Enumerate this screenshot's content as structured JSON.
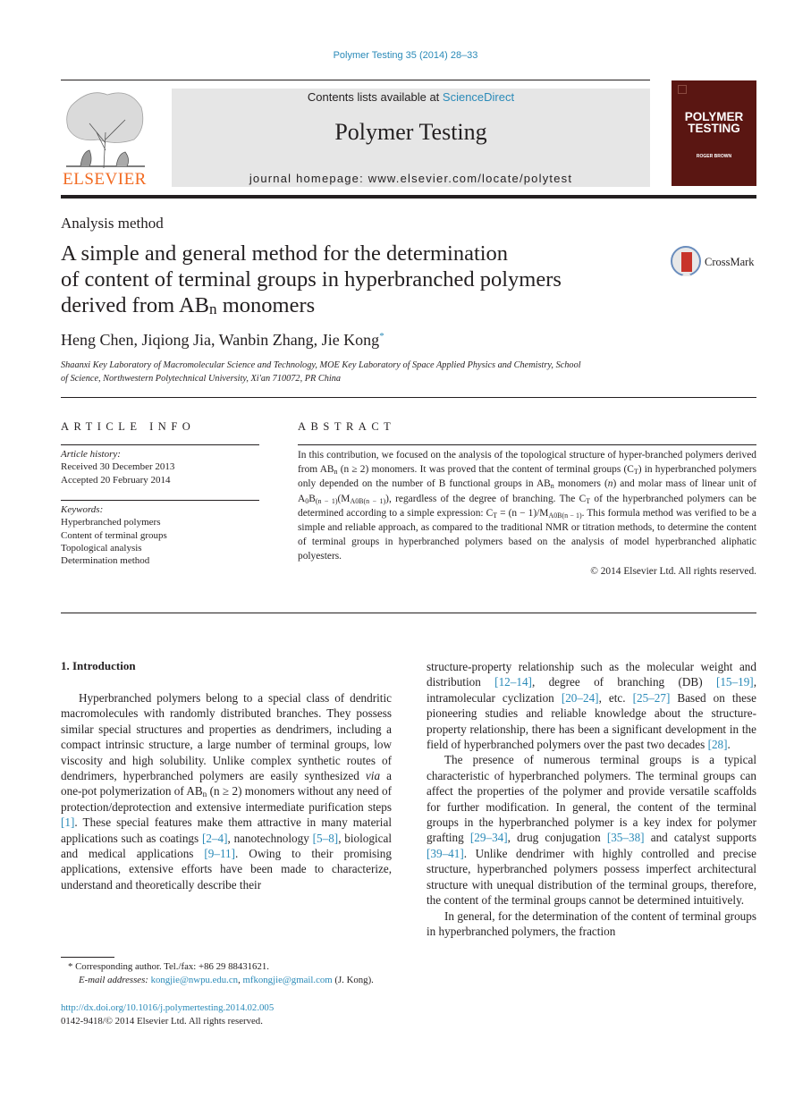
{
  "header": {
    "citation": "Polymer Testing 35 (2014) 28–33",
    "contents_prefix": "Contents lists available at ",
    "contents_link": "ScienceDirect",
    "journal_name": "Polymer Testing",
    "homepage": "journal homepage: www.elsevier.com/locate/polytest",
    "publisher_logo": "ELSEVIER",
    "cover": {
      "title_line1": "POLYMER",
      "title_line2": "TESTING",
      "editor": "ROGER BROWN",
      "bg_color": "#5a1612"
    }
  },
  "article": {
    "section_label": "Analysis method",
    "title_line1": "A simple and general method for the determination",
    "title_line2": "of content of terminal groups in hyperbranched polymers",
    "title_line3_pre": "derived from AB",
    "title_line3_sub": "n",
    "title_line3_post": " monomers",
    "crossmark_label": "CrossMark",
    "authors": "Heng Chen, Jiqiong Jia, Wanbin Zhang, Jie Kong",
    "corresponding_mark": "*",
    "affiliation_line1": "Shaanxi Key Laboratory of Macromolecular Science and Technology, MOE Key Laboratory of Space Applied Physics and Chemistry, School",
    "affiliation_line2": "of Science, Northwestern Polytechnical University, Xi'an 710072, PR China"
  },
  "article_info": {
    "heading": "ARTICLE INFO",
    "history_label": "Article history:",
    "received": "Received 30 December 2013",
    "accepted": "Accepted 20 February 2014",
    "keywords_label": "Keywords:",
    "keywords": [
      "Hyperbranched polymers",
      "Content of terminal groups",
      "Topological analysis",
      "Determination method"
    ]
  },
  "abstract": {
    "heading": "ABSTRACT",
    "s1": "In this contribution, we focused on the analysis of the topological structure of hyper-branched polymers derived from AB",
    "s2": " (n ≥ 2) monomers. It was proved that the content of terminal groups (C",
    "s3": ") in hyperbranched polymers only depended on the number of B functional groups in AB",
    "s4": " monomers (",
    "s4_italic": "n",
    "s5": ") and molar mass of linear unit of A",
    "s5_sub0": "0",
    "s5_b": "B",
    "s5_sub1": "(n − 1)",
    "s6": "(M",
    "s6_sub": "A0B(n − 1)",
    "s7": "), regardless of the degree of branching. The C",
    "s8": " of the hyperbranched polymers can be determined according to a simple expression: C",
    "s9": " = (n − 1)/M",
    "s9_sub": "A0B(n − 1)",
    "s10": ". This formula method was verified to be a simple and reliable approach, as compared to the traditional NMR or titration methods, to determine the content of terminal groups in hyperbranched polymers based on the analysis of model hyperbranched aliphatic polyesters.",
    "sub_n": "n",
    "sub_T": "T",
    "copyright": "© 2014 Elsevier Ltd. All rights reserved."
  },
  "body": {
    "intro_heading": "1.  Introduction",
    "left_p1_a": "Hyperbranched polymers belong to a special class of dendritic macromolecules with randomly distributed branches. They possess similar special structures and properties as dendrimers, including a compact intrinsic structure, a large number of terminal groups, low viscosity and high solubility. Unlike complex synthetic routes of dendrimers, hyperbranched polymers are easily synthesized ",
    "left_p1_via": "via",
    "left_p1_b": " a one-pot polymerization of AB",
    "left_p1_c": " (n ≥ 2) monomers without any need of protection/deprotection and extensive intermediate purification steps ",
    "ref1": "[1]",
    "left_p1_d": ". These special features make them attractive in many material applications such as coatings ",
    "ref2": "[2–4]",
    "left_p1_e": ", nanotechnology ",
    "ref3": "[5–8]",
    "left_p1_f": ", biological and medical applications ",
    "ref4": "[9–11]",
    "left_p1_g": ". Owing to their promising applications, extensive efforts have been made to characterize, understand and theoretically describe their",
    "right_p1_a": "structure-property relationship such as the molecular weight and distribution ",
    "ref5": "[12–14]",
    "right_p1_b": ", degree of branching (DB) ",
    "ref6": "[15–19]",
    "right_p1_c": ", intramolecular cyclization ",
    "ref7": "[20–24]",
    "right_p1_d": ", etc. ",
    "ref8": "[25–27]",
    "right_p1_e": " Based on these pioneering studies and reliable knowledge about the structure-property relationship, there has been a significant development in the field of hyperbranched polymers over the past two decades ",
    "ref9": "[28]",
    "right_p1_f": ".",
    "right_p2_a": "The presence of numerous terminal groups is a typical characteristic of hyperbranched polymers. The terminal groups can affect the properties of the polymer and provide versatile scaffolds for further modification. In general, the content of the terminal groups in the hyperbranched polymer is a key index for polymer grafting ",
    "ref10": "[29–34]",
    "right_p2_b": ", drug conjugation ",
    "ref11": "[35–38]",
    "right_p2_c": " and catalyst supports ",
    "ref12": "[39–41]",
    "right_p2_d": ". Unlike dendrimer with highly controlled and precise structure, hyperbranched polymers possess imperfect architectural structure with unequal distribution of the terminal groups, therefore, the content of the terminal groups cannot be determined intuitively.",
    "right_p3": "In general, for the determination of the content of terminal groups in hyperbranched polymers, the fraction"
  },
  "footnote": {
    "mark": "*",
    "corresponding": " Corresponding author. Tel./fax: +86 29 88431621.",
    "email_label": "E-mail addresses:",
    "email1": "kongjie@nwpu.edu.cn",
    "sep": ", ",
    "email2": "mfkongjie@gmail.com",
    "email_suffix": " (J. Kong).",
    "doi": "http://dx.doi.org/10.1016/j.polymertesting.2014.02.005",
    "issn": "0142-9418/© 2014 Elsevier Ltd. All rights reserved."
  }
}
